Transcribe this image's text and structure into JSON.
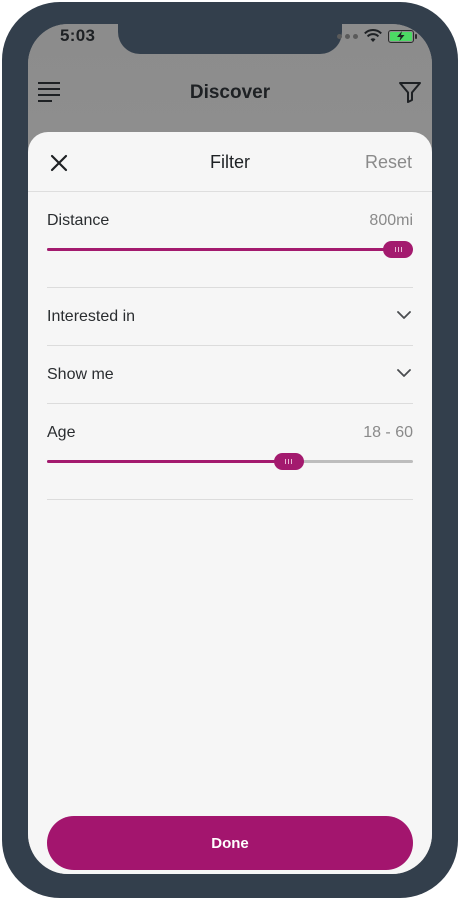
{
  "status_bar": {
    "time": "5:03"
  },
  "app_header": {
    "title": "Discover"
  },
  "filter_sheet": {
    "title": "Filter",
    "reset_label": "Reset",
    "distance": {
      "label": "Distance",
      "value": "800mi",
      "fill_fraction": 1.0
    },
    "interested_in": {
      "label": "Interested in"
    },
    "show_me": {
      "label": "Show me"
    },
    "age": {
      "label": "Age",
      "value": "18 - 60",
      "fill_fraction": 0.66
    },
    "done_label": "Done"
  },
  "colors": {
    "accent": "#a3156e",
    "frame": "#333f4c",
    "sheet_bg": "#f6f6f6",
    "muted_text": "#8a8a8a"
  }
}
